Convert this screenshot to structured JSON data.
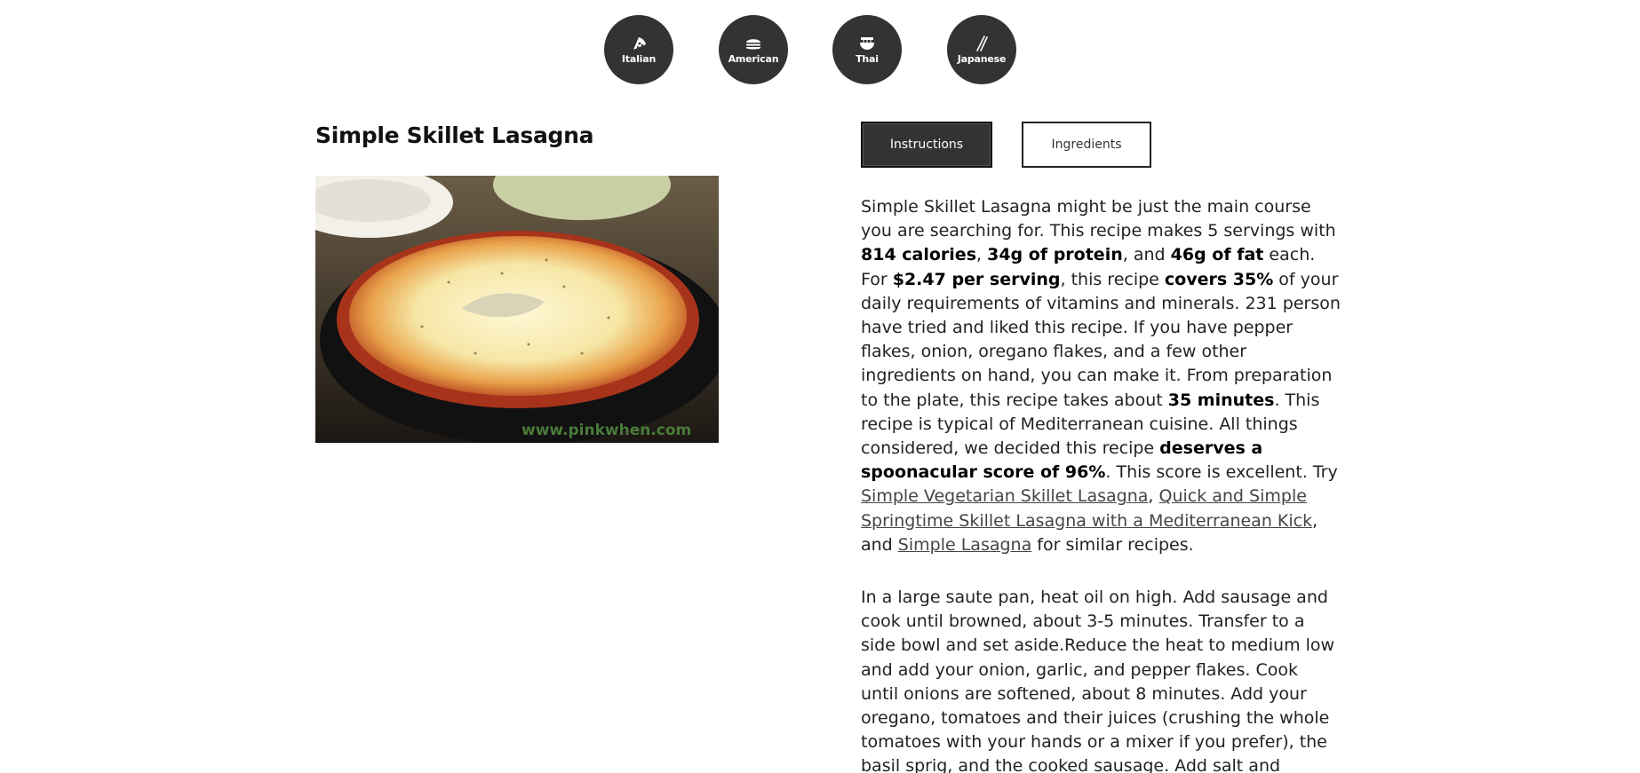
{
  "cuisines": [
    {
      "label": "Italian",
      "icon": "pizza-icon"
    },
    {
      "label": "American",
      "icon": "burger-icon"
    },
    {
      "label": "Thai",
      "icon": "noodle-bowl-icon"
    },
    {
      "label": "Japanese",
      "icon": "chopsticks-icon"
    }
  ],
  "recipe": {
    "title": "Simple Skillet Lasagna",
    "image_watermark": "www.pinkwhen.com"
  },
  "tabs": {
    "instructions": "Instructions",
    "ingredients": "Ingredients",
    "active": "instructions"
  },
  "summary": {
    "t1": "Simple Skillet Lasagna might be just the main course you are searching for. This recipe makes 5 servings with ",
    "calories": "814 calories",
    "t2": ", ",
    "protein": "34g of protein",
    "t3": ", and ",
    "fat": "46g of fat",
    "t4": " each. For ",
    "price": "$2.47 per serving",
    "t5": ", this recipe ",
    "covers": "covers 35%",
    "t6": " of your daily requirements of vitamins and minerals. 231 person have tried and liked this recipe. If you have pepper flakes, onion, oregano flakes, and a few other ingredients on hand, you can make it. From preparation to the plate, this recipe takes about ",
    "time": "35 minutes",
    "t7": ". This recipe is typical of Mediterranean cuisine. All things considered, we decided this recipe ",
    "score": "deserves a spoonacular score of 96%",
    "t8": ". This score is excellent. Try ",
    "link1": "Simple Vegetarian Skillet Lasagna",
    "t9": ", ",
    "link2": "Quick and Simple Springtime Skillet Lasagna with a Mediterranean Kick",
    "t10": ", and ",
    "link3": "Simple Lasagna",
    "t11": " for similar recipes."
  },
  "instructions_text": "In a large saute pan, heat oil on high. Add sausage and cook until browned, about 3-5 minutes. Transfer to a side bowl and set aside.Reduce the heat to medium low and add your onion, garlic, and pepper flakes. Cook until onions are softened, about 8 minutes. Add your oregano, tomatoes and their juices (crushing the whole tomatoes with your hands or a mixer if you prefer), the basil sprig, and the cooked sausage. Add salt and",
  "colors": {
    "nav_circle": "#333333",
    "tab_active_bg": "#333333",
    "link": "#444444"
  }
}
